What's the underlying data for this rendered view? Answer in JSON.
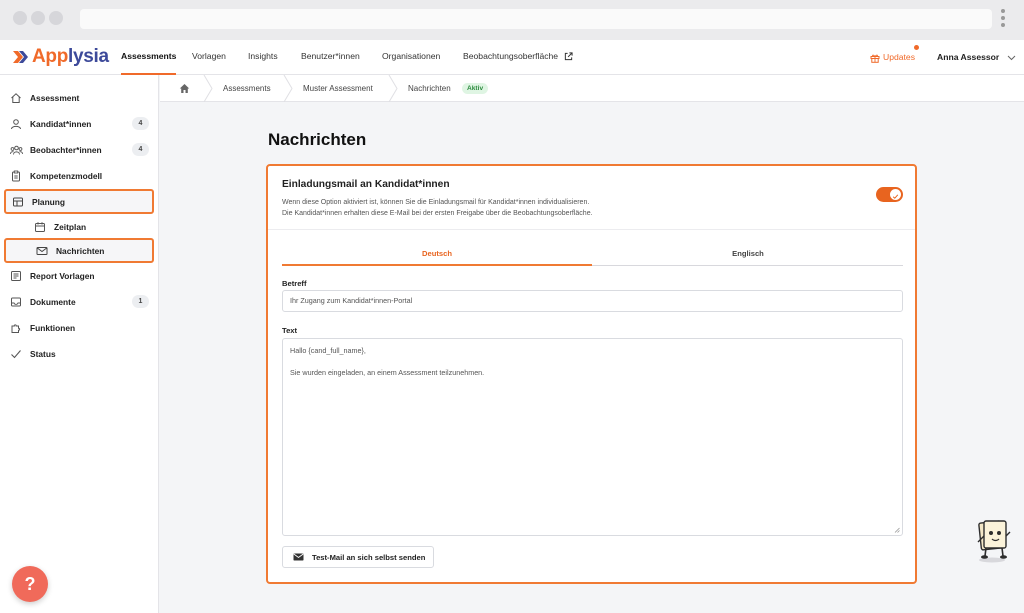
{
  "brand": {
    "name_a": "App",
    "name_b": "lysia"
  },
  "topnav": {
    "items": [
      {
        "label": "Assessments",
        "active": true
      },
      {
        "label": "Vorlagen"
      },
      {
        "label": "Insights"
      },
      {
        "label": "Benutzer*innen"
      },
      {
        "label": "Organisationen"
      },
      {
        "label": "Beobachtungsoberfläche"
      }
    ],
    "updates_label": "Updates",
    "user_name": "Anna Assessor"
  },
  "sidebar": {
    "items": [
      {
        "label": "Assessment",
        "icon": "home-icon"
      },
      {
        "label": "Kandidat*innen",
        "icon": "users-icon",
        "count": "4"
      },
      {
        "label": "Beobachter*innen",
        "icon": "group-icon",
        "count": "4"
      },
      {
        "label": "Kompetenzmodell",
        "icon": "clipboard-icon"
      },
      {
        "label": "Planung",
        "icon": "layout-icon",
        "highlighted": true
      },
      {
        "label": "Zeitplan",
        "icon": "calendar-icon",
        "sub": true
      },
      {
        "label": "Nachrichten",
        "icon": "mail-icon",
        "sub": true,
        "highlighted": true
      },
      {
        "label": "Report Vorlagen",
        "icon": "report-icon"
      },
      {
        "label": "Dokumente",
        "icon": "inbox-icon",
        "count": "1"
      },
      {
        "label": "Funktionen",
        "icon": "puzzle-icon"
      },
      {
        "label": "Status",
        "icon": "check-icon"
      }
    ],
    "help_label": "?"
  },
  "breadcrumb": {
    "items": [
      "Assessments",
      "Muster Assessment",
      "Nachrichten"
    ],
    "status": "Aktiv"
  },
  "main": {
    "title": "Nachrichten",
    "card": {
      "title": "Einladungsmail an Kandidat*innen",
      "desc_line1": "Wenn diese Option aktiviert ist, können Sie die Einladungsmail für Kandidat*innen individualisieren.",
      "desc_line2": "Die Kandidat*innen erhalten diese E-Mail bei der ersten Freigabe über die Beobachtungsoberfläche.",
      "toggle_on": true,
      "tabs": [
        {
          "label": "Deutsch",
          "active": true
        },
        {
          "label": "Englisch"
        }
      ],
      "subject_label": "Betreff",
      "subject_value": "Ihr Zugang zum Kandidat*innen-Portal",
      "text_label": "Text",
      "text_line1": "Hallo {cand_full_name},",
      "text_line2": "Sie wurden eingeladen, an einem Assessment teilzunehmen.",
      "test_button": "Test-Mail an sich selbst senden"
    }
  },
  "colors": {
    "accent": "#f06a2a",
    "brand_blue": "#3d4a9a",
    "success_bg": "#dff5e3",
    "success_text": "#2c8a3e"
  }
}
